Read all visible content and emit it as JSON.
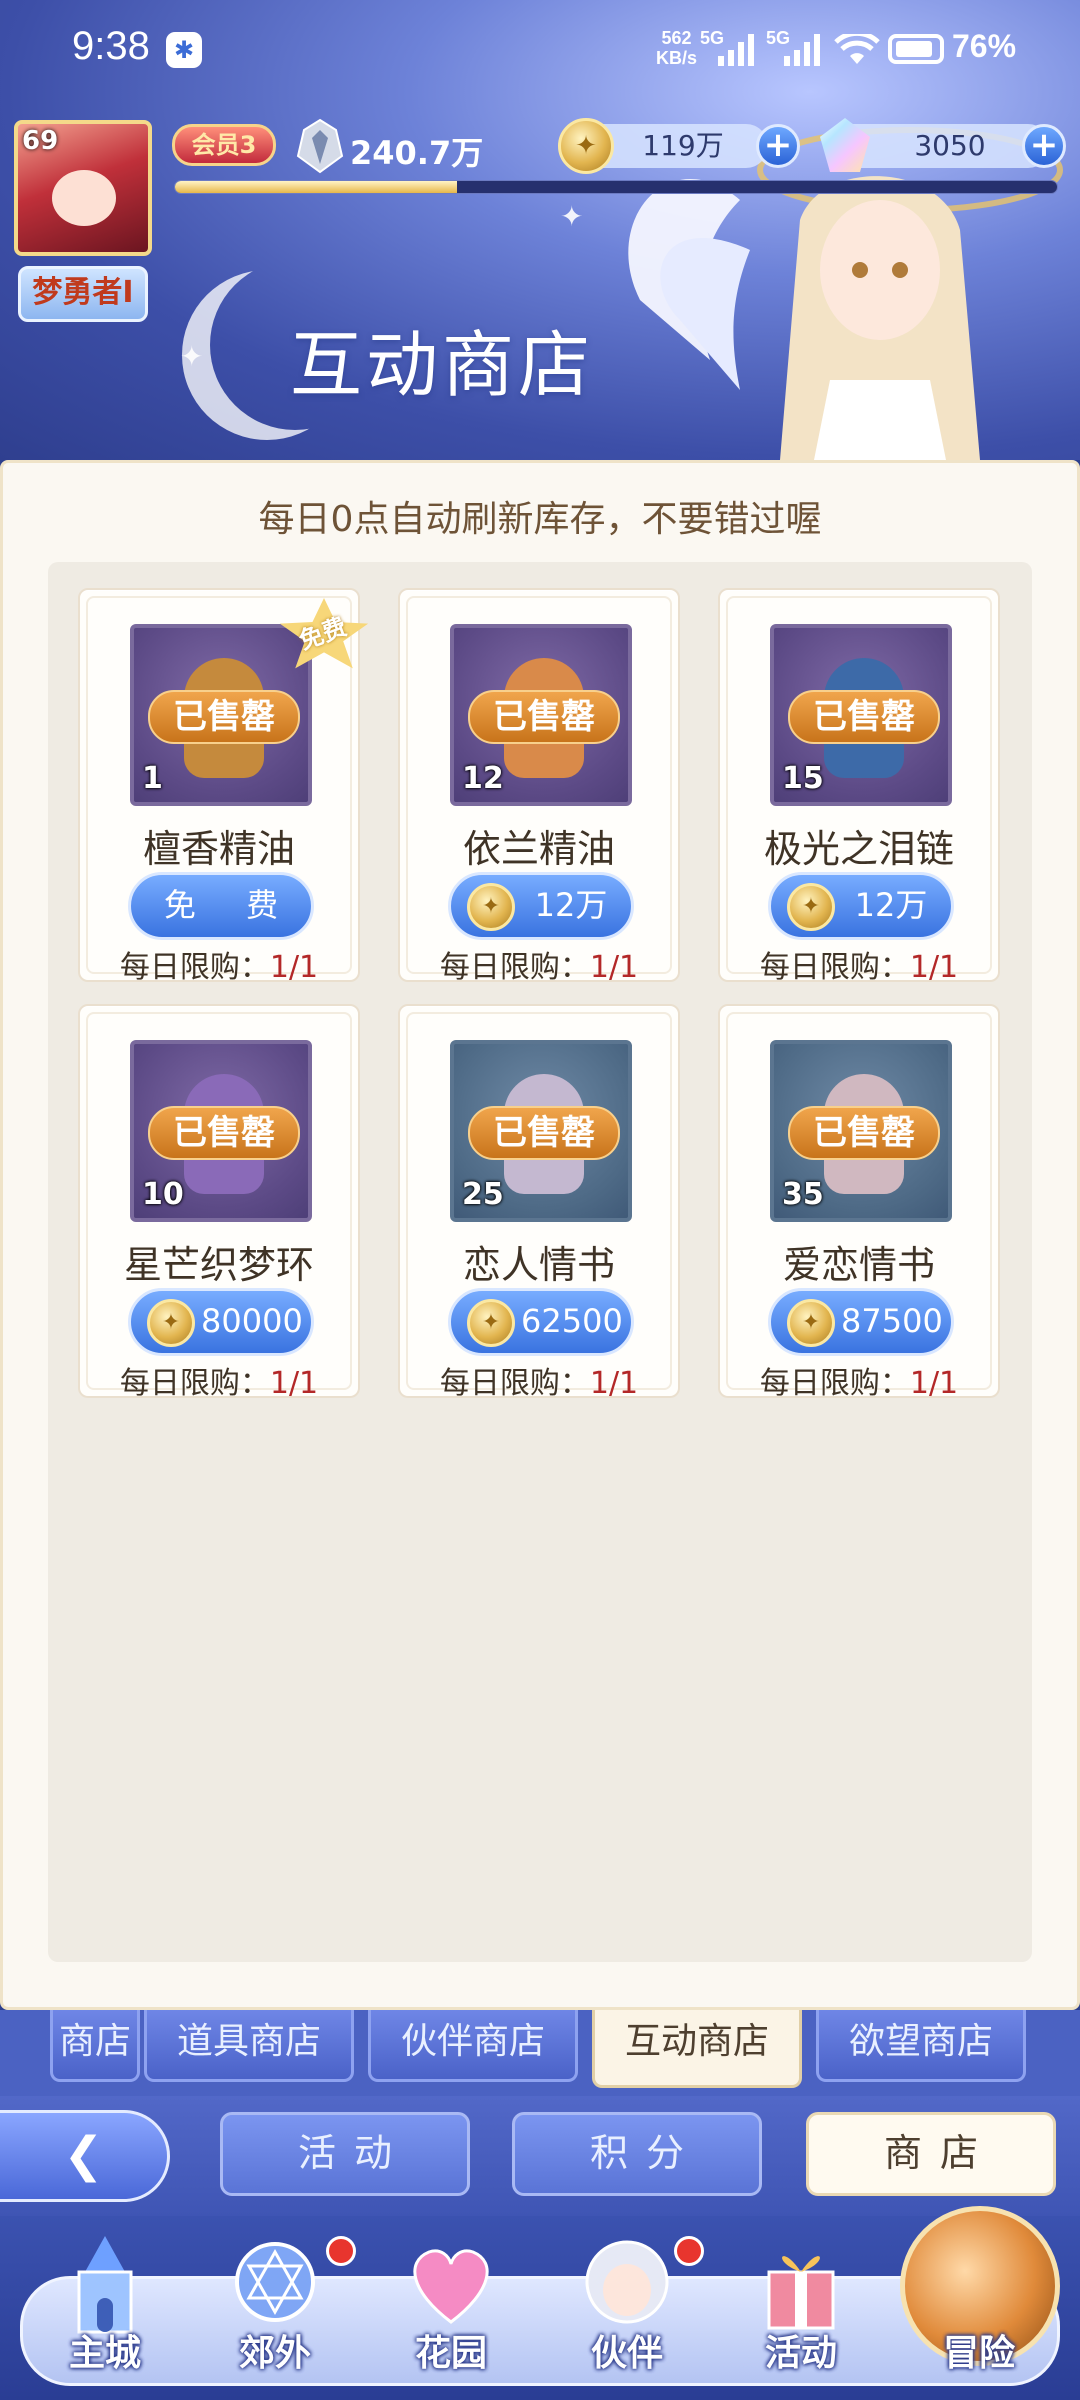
{
  "status_bar": {
    "time": "9:38",
    "net_speed_top": "562",
    "net_speed_bottom": "KB/s",
    "sim1": "5G",
    "sim2": "5G",
    "battery": "76%"
  },
  "player": {
    "level": "69",
    "name": "梦勇者I",
    "vip": "会员3",
    "power": "240.7万",
    "exp_progress": 0.32
  },
  "currencies": {
    "gold": "119万",
    "gems": "3050"
  },
  "page_title": "互动商店",
  "notice": "每日0点自动刷新库存，不要错过喔",
  "items": [
    {
      "name": "檀香精油",
      "qty": "1",
      "sold": "已售罄",
      "price": "免 费",
      "price_type": "free",
      "badge": "免费",
      "limit_label": "每日限购：",
      "limit": "1/1",
      "box": "purple",
      "art_color": "#c58a3d"
    },
    {
      "name": "依兰精油",
      "qty": "12",
      "sold": "已售罄",
      "price": "12万",
      "price_type": "gold",
      "badge": "",
      "limit_label": "每日限购：",
      "limit": "1/1",
      "box": "purple",
      "art_color": "#d98a4a"
    },
    {
      "name": "极光之泪链",
      "qty": "15",
      "sold": "已售罄",
      "price": "12万",
      "price_type": "gold",
      "badge": "",
      "limit_label": "每日限购：",
      "limit": "1/1",
      "box": "purple",
      "art_color": "#3d6aa8"
    },
    {
      "name": "星芒织梦环",
      "qty": "10",
      "sold": "已售罄",
      "price": "80000",
      "price_type": "gold",
      "badge": "",
      "limit_label": "每日限购：",
      "limit": "1/1",
      "box": "purple",
      "art_color": "#8a6ab8"
    },
    {
      "name": "恋人情书",
      "qty": "25",
      "sold": "已售罄",
      "price": "62500",
      "price_type": "gold",
      "badge": "",
      "limit_label": "每日限购：",
      "limit": "1/1",
      "box": "blue",
      "art_color": "#c4b8d0"
    },
    {
      "name": "爱恋情书",
      "qty": "35",
      "sold": "已售罄",
      "price": "87500",
      "price_type": "gold",
      "badge": "",
      "limit_label": "每日限购：",
      "limit": "1/1",
      "box": "blue",
      "art_color": "#d0b8c0"
    }
  ],
  "shop_tabs": [
    "商店",
    "道具商店",
    "伙伴商店",
    "互动商店",
    "欲望商店"
  ],
  "active_tab": "互动商店",
  "nav": {
    "activity": "活动",
    "points": "积分",
    "shop": "商店"
  },
  "dock": [
    {
      "label": "主城",
      "icon": "castle-icon",
      "dot": false
    },
    {
      "label": "郊外",
      "icon": "magic-circle-icon",
      "dot": true
    },
    {
      "label": "花园",
      "icon": "heart-icon",
      "dot": false
    },
    {
      "label": "伙伴",
      "icon": "partner-icon",
      "dot": true
    },
    {
      "label": "活动",
      "icon": "gift-icon",
      "dot": false
    },
    {
      "label": "冒险",
      "icon": "adventure-icon",
      "dot": false
    }
  ],
  "colors": {
    "accent_blue": "#3a73e0",
    "sold_orange": "#c8741b",
    "limit_red": "#b32828",
    "panel_bg": "#fbf8f2"
  }
}
